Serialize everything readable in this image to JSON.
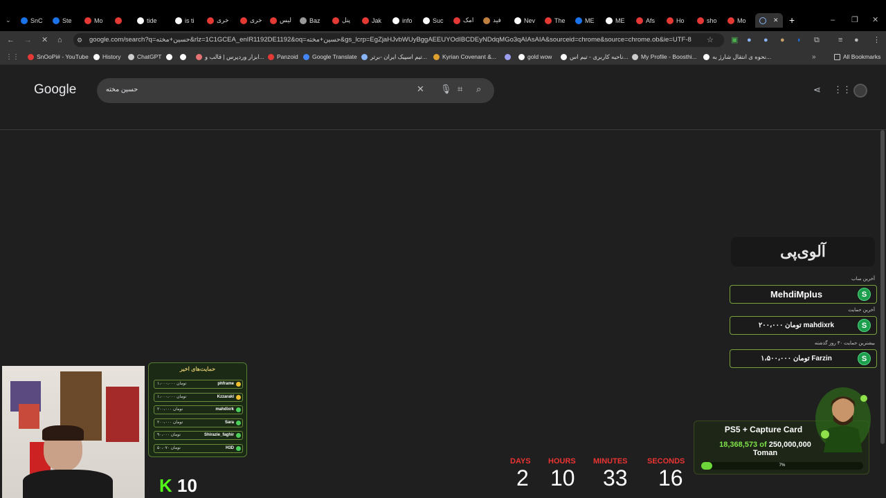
{
  "browser": {
    "tabs": [
      {
        "label": "SnC",
        "color": "#1a73e8"
      },
      {
        "label": "Ste",
        "color": "#1a73e8"
      },
      {
        "label": "Mo",
        "color": "#e53935"
      },
      {
        "label": "",
        "color": "#e53935"
      },
      {
        "label": "tide",
        "color": "#ffffff"
      },
      {
        "label": "is ti",
        "color": "#ffffff"
      },
      {
        "label": "خری",
        "color": "#e53935"
      },
      {
        "label": "خری",
        "color": "#e53935"
      },
      {
        "label": "لیس",
        "color": "#e53935"
      },
      {
        "label": "Baz",
        "color": "#999999"
      },
      {
        "label": "پنل",
        "color": "#e53935"
      },
      {
        "label": "Jak",
        "color": "#e53935"
      },
      {
        "label": "info",
        "color": "#ffffff"
      },
      {
        "label": "Suc",
        "color": "#ffffff"
      },
      {
        "label": "امک",
        "color": "#e53935"
      },
      {
        "label": "فید",
        "color": "#c08040"
      },
      {
        "label": "Nev",
        "color": "#ffffff"
      },
      {
        "label": "The",
        "color": "#e53935"
      },
      {
        "label": "ME",
        "color": "#1a73e8"
      },
      {
        "label": "ME",
        "color": "#ffffff"
      },
      {
        "label": "Afs",
        "color": "#e53935"
      },
      {
        "label": "Ho",
        "color": "#e53935"
      },
      {
        "label": "sho",
        "color": "#e53935"
      },
      {
        "label": "Mo",
        "color": "#e53935"
      }
    ],
    "url": "google.com/search?q=حسین+مخته&rlz=1C1GCEA_enIR1192DE1192&oq=حسین+مخته&gs_lcrp=EgZjaHJvbWUyBggAEEUYOdIBCDEyNDdqMGo3qAIAsAIA&sourceid=chrome&source=chrome.ob&ie=UTF-8",
    "bookmarks": [
      {
        "label": "SnOoPi# - YouTube",
        "color": "#e53935"
      },
      {
        "label": "History",
        "color": "#ffffff"
      },
      {
        "label": "ChatGPT",
        "color": "#cccccc"
      },
      {
        "label": "",
        "color": "#ffffff"
      },
      {
        "label": "",
        "color": "#ffffff"
      },
      {
        "label": "ابزار وردپرس | قالب و...",
        "color": "#e57373"
      },
      {
        "label": "Panzoid",
        "color": "#e53935"
      },
      {
        "label": "Google Translate",
        "color": "#4285f4"
      },
      {
        "label": "تیم اسپیک ایران -برتر...",
        "color": "#8ab4f8"
      },
      {
        "label": "Kyrian Covenant &...",
        "color": "#e0a030"
      },
      {
        "label": "",
        "color": "#9e9ef0"
      },
      {
        "label": "gold wow",
        "color": "#ffffff"
      },
      {
        "label": "ناحیه کاربری - تیم اس...",
        "color": "#ffffff"
      },
      {
        "label": "My Profile - Boosthi...",
        "color": "#cccccc"
      },
      {
        "label": "نحوه ی انتقال شارژ به...",
        "color": "#ffffff"
      }
    ],
    "all_bookmarks": "All Bookmarks"
  },
  "google": {
    "logo": "Google",
    "query": "حسین مخته"
  },
  "overlay": {
    "brand": "آلوی‌پی",
    "last_sub_label": "آخرین ساب",
    "last_sub": "MehdiMplus",
    "last_donation_label": "آخرین حمایت",
    "last_donation": "۲۰۰،۰۰۰ تومان  mahdixrk",
    "top_donation_label": "بیشترین حمایت ۳۰ روز گذشته",
    "top_donation": "۱،۵۰۰،۰۰۰ تومان  Farzin",
    "coin": "S",
    "recent_title": "حمایت‌های اخیر",
    "recent": [
      {
        "name": "phframe",
        "amount": "۱،۰۰۰،۰۰۰ تومان"
      },
      {
        "name": "Kzzarakl",
        "amount": "۱،۰۰۰،۰۰۰ تومان"
      },
      {
        "name": "mahdixrk",
        "amount": "۲۰۰،۰۰۰ تومان"
      },
      {
        "name": "Sara",
        "amount": "۲۰۰،۰۰۰ تومان"
      },
      {
        "name": "Shirazie_faghir",
        "amount": "۹۰،۰۰۰ تومان"
      },
      {
        "name": "H3D",
        "amount": "۵۰،۰۷۰ تومان"
      }
    ],
    "kick_count": "10",
    "countdown": {
      "days_label": "DAYS",
      "days": "2",
      "hours_label": "HOURS",
      "hours": "10",
      "minutes_label": "MINUTES",
      "minutes": "33",
      "seconds_label": "SECONDS",
      "seconds": "16"
    },
    "goal": {
      "title": "PS5 + Capture Card",
      "raised": "18,368,573",
      "of": "of",
      "target": "250,000,000",
      "currency": "Toman",
      "percent_label": "7%",
      "progress": 0.07
    }
  }
}
